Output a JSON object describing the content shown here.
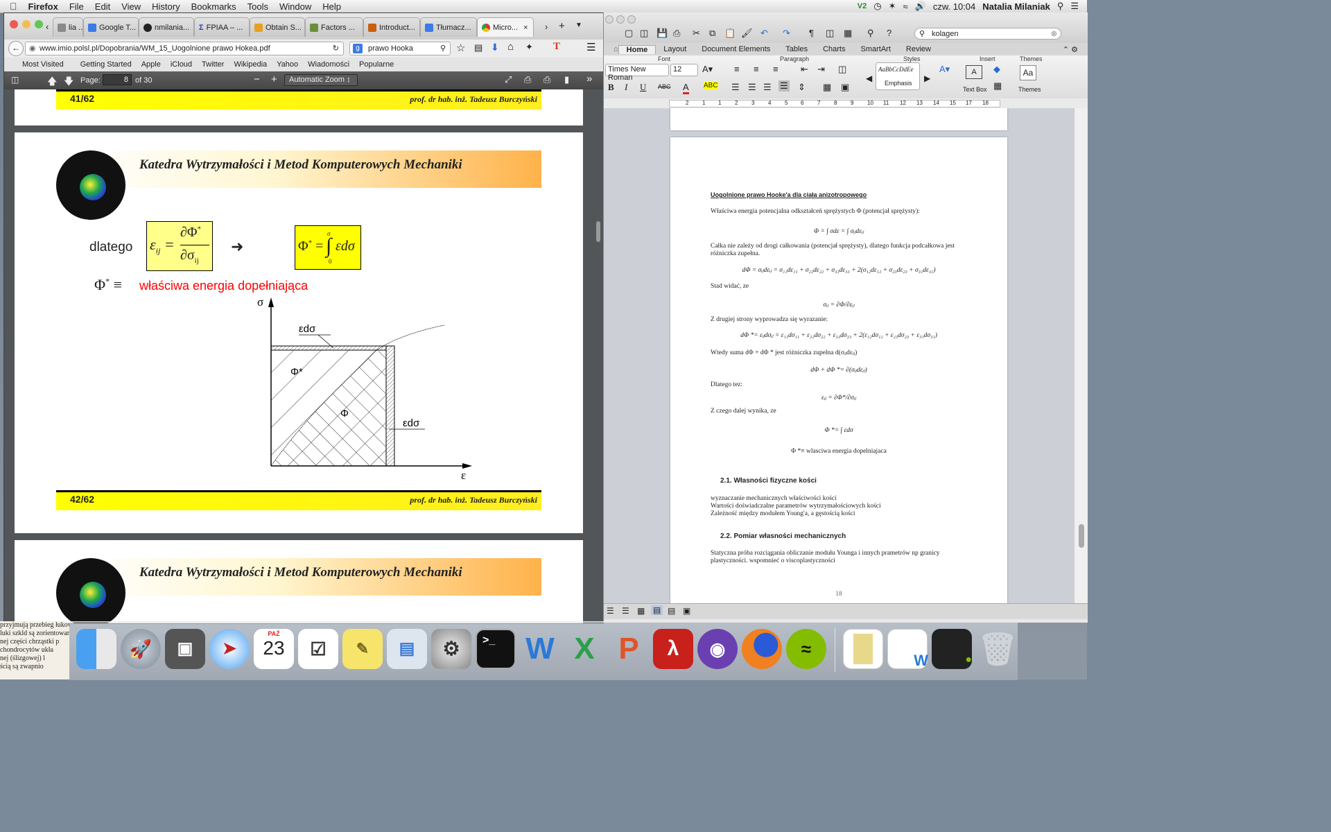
{
  "menubar": {
    "apple": "",
    "app": "Firefox",
    "items": [
      "File",
      "Edit",
      "View",
      "History",
      "Bookmarks",
      "Tools",
      "Window",
      "Help"
    ],
    "clock": "czw. 10:04",
    "user": "Natalia Milaniak"
  },
  "firefox": {
    "tabs": [
      {
        "label": "lia ...",
        "color": "#8a8a8a"
      },
      {
        "label": "Google T...",
        "color": "#3b7be6"
      },
      {
        "label": "nmilania...",
        "color": "#222222"
      },
      {
        "label": "FPIAA – ...",
        "color": "#2a3bb0"
      },
      {
        "label": "Obtain S...",
        "color": "#e6a020"
      },
      {
        "label": "Factors ...",
        "color": "#6a8f3a"
      },
      {
        "label": "Introduct...",
        "color": "#c86010"
      },
      {
        "label": "Tłumacz...",
        "color": "#3b7be6"
      },
      {
        "label": "Micro...",
        "color": "#d23a2a"
      }
    ],
    "url": "www.imio.polsl.pl/Dopobrania/WM_15_Uogolnione prawo Hokea.pdf",
    "search": "prawo Hooka",
    "bookmarks": [
      "Most Visited",
      "Getting Started",
      "Apple",
      "iCloud",
      "Twitter",
      "Wikipedia",
      "Yahoo",
      "Wiadomości",
      "Popularne"
    ],
    "pdf": {
      "page_label": "Page:",
      "page": "8",
      "of": "of 30",
      "zoom": "Automatic Zoom",
      "page_top_number": "41/62",
      "author": "prof. dr hab. inż. Tadeusz Burczyński",
      "header_title": "Katedra Wytrzymałości i Metod Komputerowych Mechaniki",
      "dlatego": "dlatego",
      "phi_star_def": "właściwa energia dopełniająca",
      "page_bottom_number": "42/62",
      "chart_labels": {
        "sigma": "σ",
        "eps": "ε",
        "eds_top": "εdσ",
        "eds_right": "εdσ",
        "phi_star": "Φ*",
        "phi": "Φ"
      }
    }
  },
  "word": {
    "search": "kolagen",
    "tabs": [
      "Home",
      "Layout",
      "Document Elements",
      "Tables",
      "Charts",
      "SmartArt",
      "Review"
    ],
    "groups": [
      "Font",
      "Paragraph",
      "Styles",
      "Insert",
      "Themes"
    ],
    "font_name": "Times New Roman",
    "font_size": "12",
    "style_name": "Emphasis",
    "style_preview": "AaBbCcDdEe",
    "textbox_label": "Text Box",
    "themes_label": "Themes",
    "ruler_numbers": [
      "2",
      "1",
      "1",
      "2",
      "3",
      "4",
      "5",
      "6",
      "7",
      "8",
      "9",
      "10",
      "11",
      "12",
      "13",
      "14",
      "15",
      "17",
      "18"
    ],
    "doc": {
      "title": "Uogolnione prawo Hooke'a dla ciała anizotropowego",
      "p1": "Właściwa energia potencjalna odkształceń sprężystych Φ (potencjał sprężysty):",
      "eq1": "Φ = ∫ σdε = ∫ σᵢⱼdεᵢⱼ",
      "p2a": "Całka nie zależy od drogi całkowania (potencjał sprężysty), dlatego funkcja podcałkowa jest",
      "p2b": "różniczka zupełna.",
      "eq2": "dΦ = σᵢⱼdεᵢⱼ = σ₁₁dε₁₁ + σ₂₂dε₂₂ + σ₃₃dε₃₃ + 2(σ₁₂dε₁₂ + σ₂₃dε₂₃ + σ₃₁dε₃₁)",
      "p3": "Stad widać, ze",
      "eq3": "σᵢⱼ = ∂Φ/∂εᵢⱼ",
      "p4": "Z drugiej strony wyprowadza się wyrazanie:",
      "eq4": "dΦ *= εᵢⱼdσᵢⱼ = ε₁₁dσ₁₁ + ε₂₂dσ₂₂ + ε₃₃dσ₃₃ + 2(ε₁₂dσ₁₂ + ε₂₃dσ₂₃ + ε₃₁dσ₃₁)",
      "p5": "Wtedy suma dΦ + dΦ * jest różniczka zupelna d(σᵢⱼdεᵢⱼ)",
      "eq5": "dΦ + dΦ *= ∂(σᵢⱼdεᵢⱼ)",
      "p6": "Dlatego tez:",
      "eq6": "εᵢⱼ = ∂Φ*/∂σᵢⱼ",
      "p7": "Z czego dalej wynika, ze",
      "eq7": "Φ *= ∫ εdσ",
      "eq8": "Φ *≡ wlasciwa energia dopelniajaca",
      "h21": "2.1.     Własności fizyczne kości",
      "l1": "wyznaczanie mechanicznych właściwości kości",
      "l2": "Wartości doświadczalne parametrów wytrzymałościowych kości",
      "l3": "Zależność między modułem Young'a, a gęstością kości",
      "h22": "2.2.     Pomiar własności mechanicznych",
      "p8a": "Statyczna  próba  rozciągania  obliczanie  modułu  Younga  i  innych  prametrów  np  granicy",
      "p8b": "plastyczności. wspomnieć o viscoplastyczności",
      "pagenum": "18"
    }
  },
  "dock": {
    "date_badge": "23",
    "date_month": "PAŹ"
  },
  "paper_snippet": [
    "przyjmują przebieg łukowaty, po czym biegną równolegle do powierzchni. Ponieważ",
    "luki szkld są zorientowane",
    "nej części chrząstki p",
    "chondrocytów ukła",
    "nej (ślizgowej) l",
    "ścią są zwapnio"
  ]
}
